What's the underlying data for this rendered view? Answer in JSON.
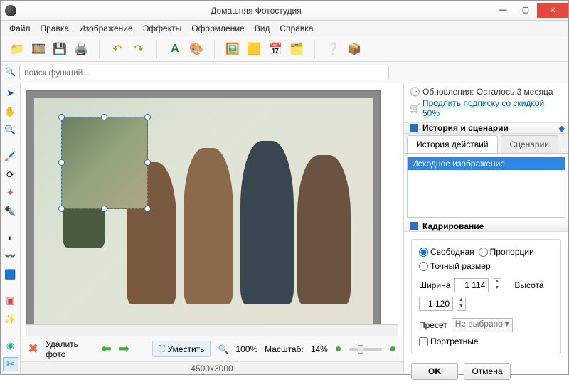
{
  "window": {
    "title": "Домашняя Фотостудия"
  },
  "menu": {
    "file": "Файл",
    "edit": "Правка",
    "image": "Изображение",
    "effects": "Эффекты",
    "design": "Оформление",
    "view": "Вид",
    "help": "Справка"
  },
  "search": {
    "placeholder": "поиск функций..."
  },
  "notice": {
    "updates": "Обновления: Осталось  3 месяца",
    "extend": "Продлить подписку со скидкой 50%"
  },
  "history": {
    "panel_title": "История и сценарии",
    "tab_history": "История действий",
    "tab_scenarios": "Сценарии",
    "items": [
      "Исходное изображение"
    ]
  },
  "crop": {
    "panel_title": "Кадрирование",
    "mode_free": "Свободная",
    "mode_proportions": "Пропорции",
    "mode_exact": "Точный размер",
    "width_label": "Ширина",
    "width_value": "1 114",
    "height_label": "Высота",
    "height_value": "1 120",
    "preset_label": "Пресет",
    "preset_value": "Не выбрано",
    "portrait_label": "Портретные",
    "ok": "OK",
    "cancel": "Отмена"
  },
  "status": {
    "delete_photo": "Удалить фото",
    "fit": "Уместить",
    "zoom_100": "100%",
    "scale_label": "Масштаб:",
    "scale_value": "14%",
    "dimensions": "4500x3000"
  }
}
